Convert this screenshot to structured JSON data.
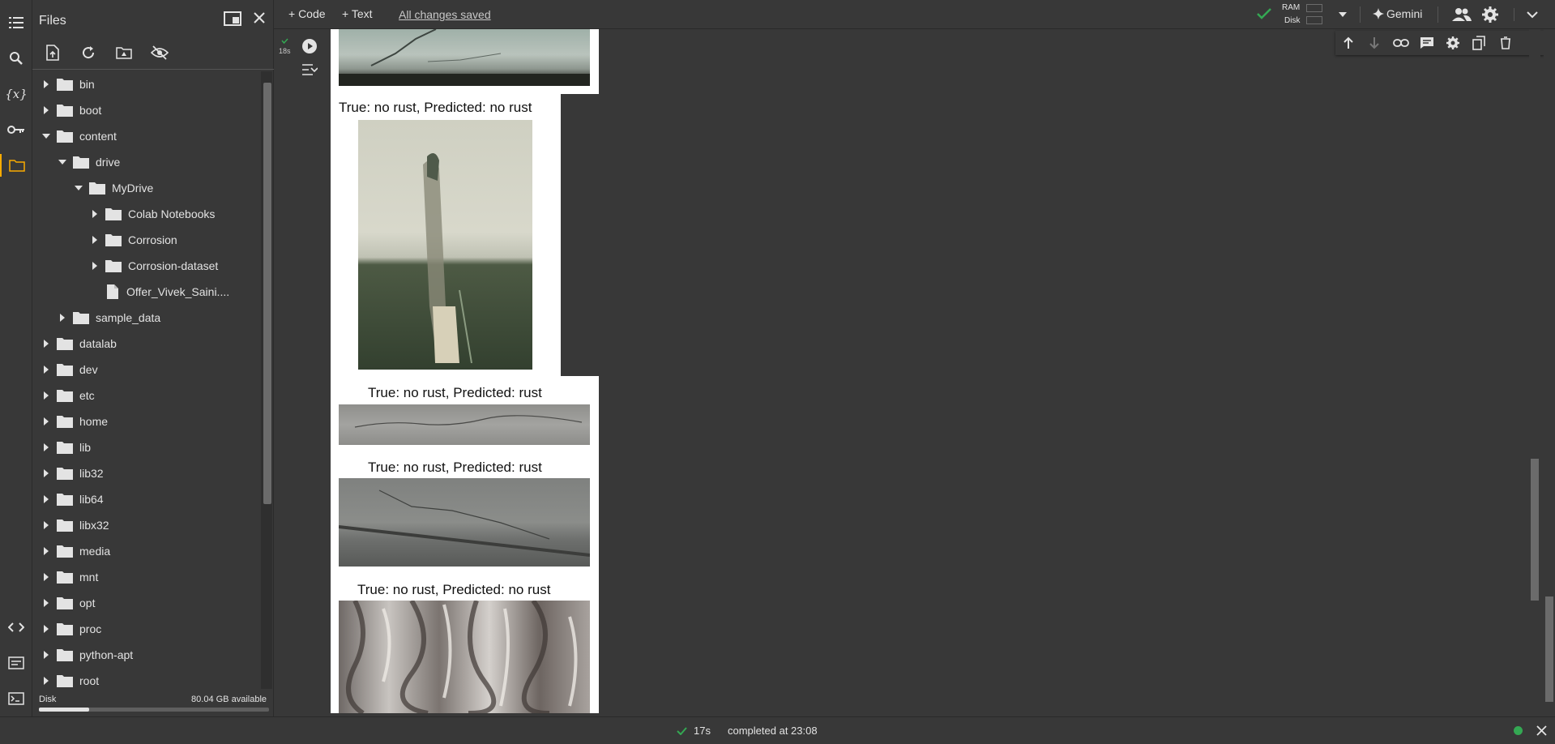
{
  "sidebar": {
    "title": "Files",
    "disk_label": "Disk",
    "disk_available": "80.04 GB available",
    "disk_used_fraction": 0.22,
    "tree": [
      {
        "label": "bin",
        "type": "folder",
        "depth": 0,
        "expanded": false
      },
      {
        "label": "boot",
        "type": "folder",
        "depth": 0,
        "expanded": false
      },
      {
        "label": "content",
        "type": "folder",
        "depth": 0,
        "expanded": true
      },
      {
        "label": "drive",
        "type": "folder",
        "depth": 1,
        "expanded": true
      },
      {
        "label": "MyDrive",
        "type": "folder",
        "depth": 2,
        "expanded": true
      },
      {
        "label": "Colab Notebooks",
        "type": "folder",
        "depth": 3,
        "expanded": false
      },
      {
        "label": "Corrosion",
        "type": "folder",
        "depth": 3,
        "expanded": false
      },
      {
        "label": "Corrosion-dataset",
        "type": "folder",
        "depth": 3,
        "expanded": false
      },
      {
        "label": "Offer_Vivek_Saini....",
        "type": "file",
        "depth": 3,
        "expanded": false
      },
      {
        "label": "sample_data",
        "type": "folder",
        "depth": 1,
        "expanded": false
      },
      {
        "label": "datalab",
        "type": "folder",
        "depth": 0,
        "expanded": false
      },
      {
        "label": "dev",
        "type": "folder",
        "depth": 0,
        "expanded": false
      },
      {
        "label": "etc",
        "type": "folder",
        "depth": 0,
        "expanded": false
      },
      {
        "label": "home",
        "type": "folder",
        "depth": 0,
        "expanded": false
      },
      {
        "label": "lib",
        "type": "folder",
        "depth": 0,
        "expanded": false
      },
      {
        "label": "lib32",
        "type": "folder",
        "depth": 0,
        "expanded": false
      },
      {
        "label": "lib64",
        "type": "folder",
        "depth": 0,
        "expanded": false
      },
      {
        "label": "libx32",
        "type": "folder",
        "depth": 0,
        "expanded": false
      },
      {
        "label": "media",
        "type": "folder",
        "depth": 0,
        "expanded": false
      },
      {
        "label": "mnt",
        "type": "folder",
        "depth": 0,
        "expanded": false
      },
      {
        "label": "opt",
        "type": "folder",
        "depth": 0,
        "expanded": false
      },
      {
        "label": "proc",
        "type": "folder",
        "depth": 0,
        "expanded": false
      },
      {
        "label": "python-apt",
        "type": "folder",
        "depth": 0,
        "expanded": false
      },
      {
        "label": "root",
        "type": "folder",
        "depth": 0,
        "expanded": false
      }
    ]
  },
  "toolbar": {
    "code_label": "+ Code",
    "text_label": "+ Text",
    "save_status": "All changes saved",
    "ram_label": "RAM",
    "disk_label": "Disk",
    "gemini_label": "Gemini"
  },
  "cell": {
    "exec_time": "18s"
  },
  "output": {
    "captions": [
      "True: no rust, Predicted: no rust",
      "True: no rust, Predicted: rust",
      "True: no rust, Predicted: rust",
      "True: no rust, Predicted: no rust"
    ]
  },
  "status": {
    "duration": "17s",
    "text": "completed at 23:08"
  },
  "colors": {
    "background": "#383838",
    "accent": "#f9ab00",
    "success": "#34a853"
  }
}
